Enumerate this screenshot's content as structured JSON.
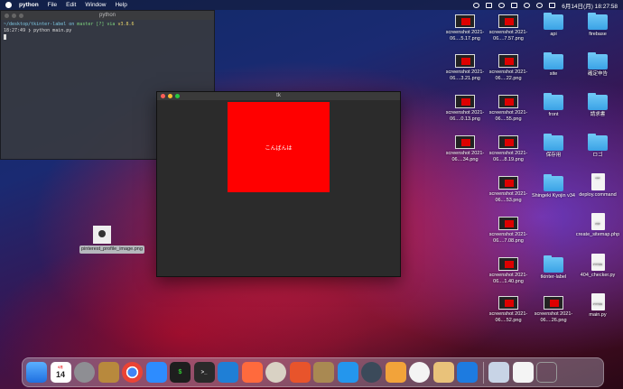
{
  "menubar": {
    "app_name": "python",
    "menus": [
      "File",
      "Edit",
      "Window",
      "Help"
    ],
    "clock": "6月14日(月) 18:27:58"
  },
  "terminal": {
    "title": "python",
    "line1_prefix": "~/desktop/tkinter-label on",
    "line1_branch": "master [?] via",
    "line1_version": "v3.8.6",
    "line2": "18:27:49 ❯ python main.py"
  },
  "tkwindow": {
    "title": "tk",
    "label_text": "こんばんは"
  },
  "desktop_icons": [
    {
      "label": "screenshot 2021-06....5.17.png",
      "kind": "thumb"
    },
    {
      "label": "screenshot 2021-06....7.57.png",
      "kind": "thumb"
    },
    {
      "label": "api",
      "kind": "folder"
    },
    {
      "label": "firebase",
      "kind": "folder"
    },
    {
      "label": "screenshot 2021-06....3.21.png",
      "kind": "thumb"
    },
    {
      "label": "screenshot 2021-06....22.png",
      "kind": "thumb"
    },
    {
      "label": "site",
      "kind": "folder"
    },
    {
      "label": "確定申告",
      "kind": "folder"
    },
    {
      "label": "screenshot 2021-06....0.13.png",
      "kind": "thumb"
    },
    {
      "label": "screenshot 2021-06....55.png",
      "kind": "thumb"
    },
    {
      "label": "front",
      "kind": "folder"
    },
    {
      "label": "請求書",
      "kind": "folder"
    },
    {
      "label": "screenshot 2021-06....34.png",
      "kind": "thumb"
    },
    {
      "label": "screenshot 2021-06....8.19.png",
      "kind": "thumb"
    },
    {
      "label": "保存用",
      "kind": "folder"
    },
    {
      "label": "ロゴ",
      "kind": "folder"
    },
    {
      "label": "screenshot 2021-06....53.png",
      "kind": "thumb"
    },
    {
      "label": "Shingeki Kyojin v34",
      "kind": "folder"
    },
    {
      "label": "deploy.command",
      "kind": "doc"
    },
    {
      "label": "screenshot 2021-06....7.08.png",
      "kind": "thumb"
    },
    {
      "label": "create_sitemap.php",
      "kind": "doc"
    },
    {
      "label": "screenshot 2021-06....1.40.png",
      "kind": "thumb"
    },
    {
      "label": "tkinter-label",
      "kind": "folder"
    },
    {
      "label": "404_checker.py",
      "kind": "doc"
    },
    {
      "label": "screenshot 2021-06....52.png",
      "kind": "thumb"
    },
    {
      "label": "screenshot 2021-06....26.png",
      "kind": "thumb"
    },
    {
      "label": "main.py",
      "kind": "doc"
    },
    {
      "label": "pinterest_profile_image.png",
      "kind": "image"
    }
  ],
  "dock": {
    "calendar_day": "14",
    "calendar_month": "6月"
  }
}
